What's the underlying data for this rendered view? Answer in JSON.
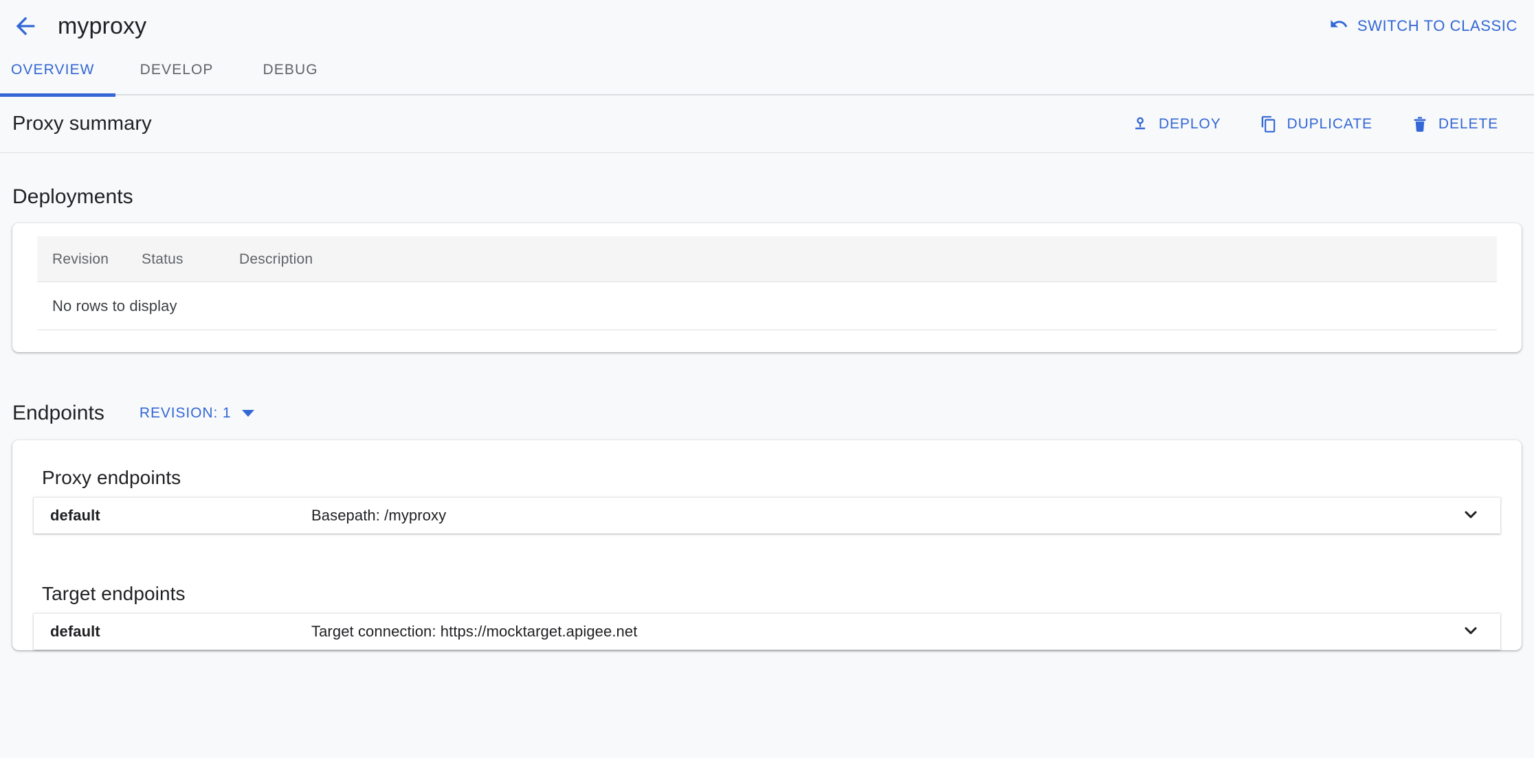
{
  "header": {
    "back_icon": "arrow-back-icon",
    "title": "myproxy",
    "switch_label": "SWITCH TO CLASSIC",
    "switch_icon": "undo-icon",
    "accent_color": "#3367d6"
  },
  "tabs": [
    {
      "label": "OVERVIEW",
      "active": true
    },
    {
      "label": "DEVELOP",
      "active": false
    },
    {
      "label": "DEBUG",
      "active": false
    }
  ],
  "summary": {
    "title": "Proxy summary",
    "actions": [
      {
        "label": "DEPLOY",
        "icon": "publish-icon"
      },
      {
        "label": "DUPLICATE",
        "icon": "copy-icon"
      },
      {
        "label": "DELETE",
        "icon": "trash-icon"
      }
    ]
  },
  "deployments": {
    "title": "Deployments",
    "columns": [
      "Revision",
      "Status",
      "Description"
    ],
    "rows": [],
    "empty_message": "No rows to display"
  },
  "endpoints": {
    "title": "Endpoints",
    "revision_label": "REVISION: 1",
    "revision_icon": "chevron-down-icon",
    "groups": [
      {
        "title": "Proxy endpoints",
        "rows": [
          {
            "name": "default",
            "detail": "Basepath: /myproxy",
            "expand_icon": "chevron-down-icon"
          }
        ]
      },
      {
        "title": "Target endpoints",
        "rows": [
          {
            "name": "default",
            "detail": "Target connection: https://mocktarget.apigee.net",
            "expand_icon": "chevron-down-icon"
          }
        ]
      }
    ]
  }
}
